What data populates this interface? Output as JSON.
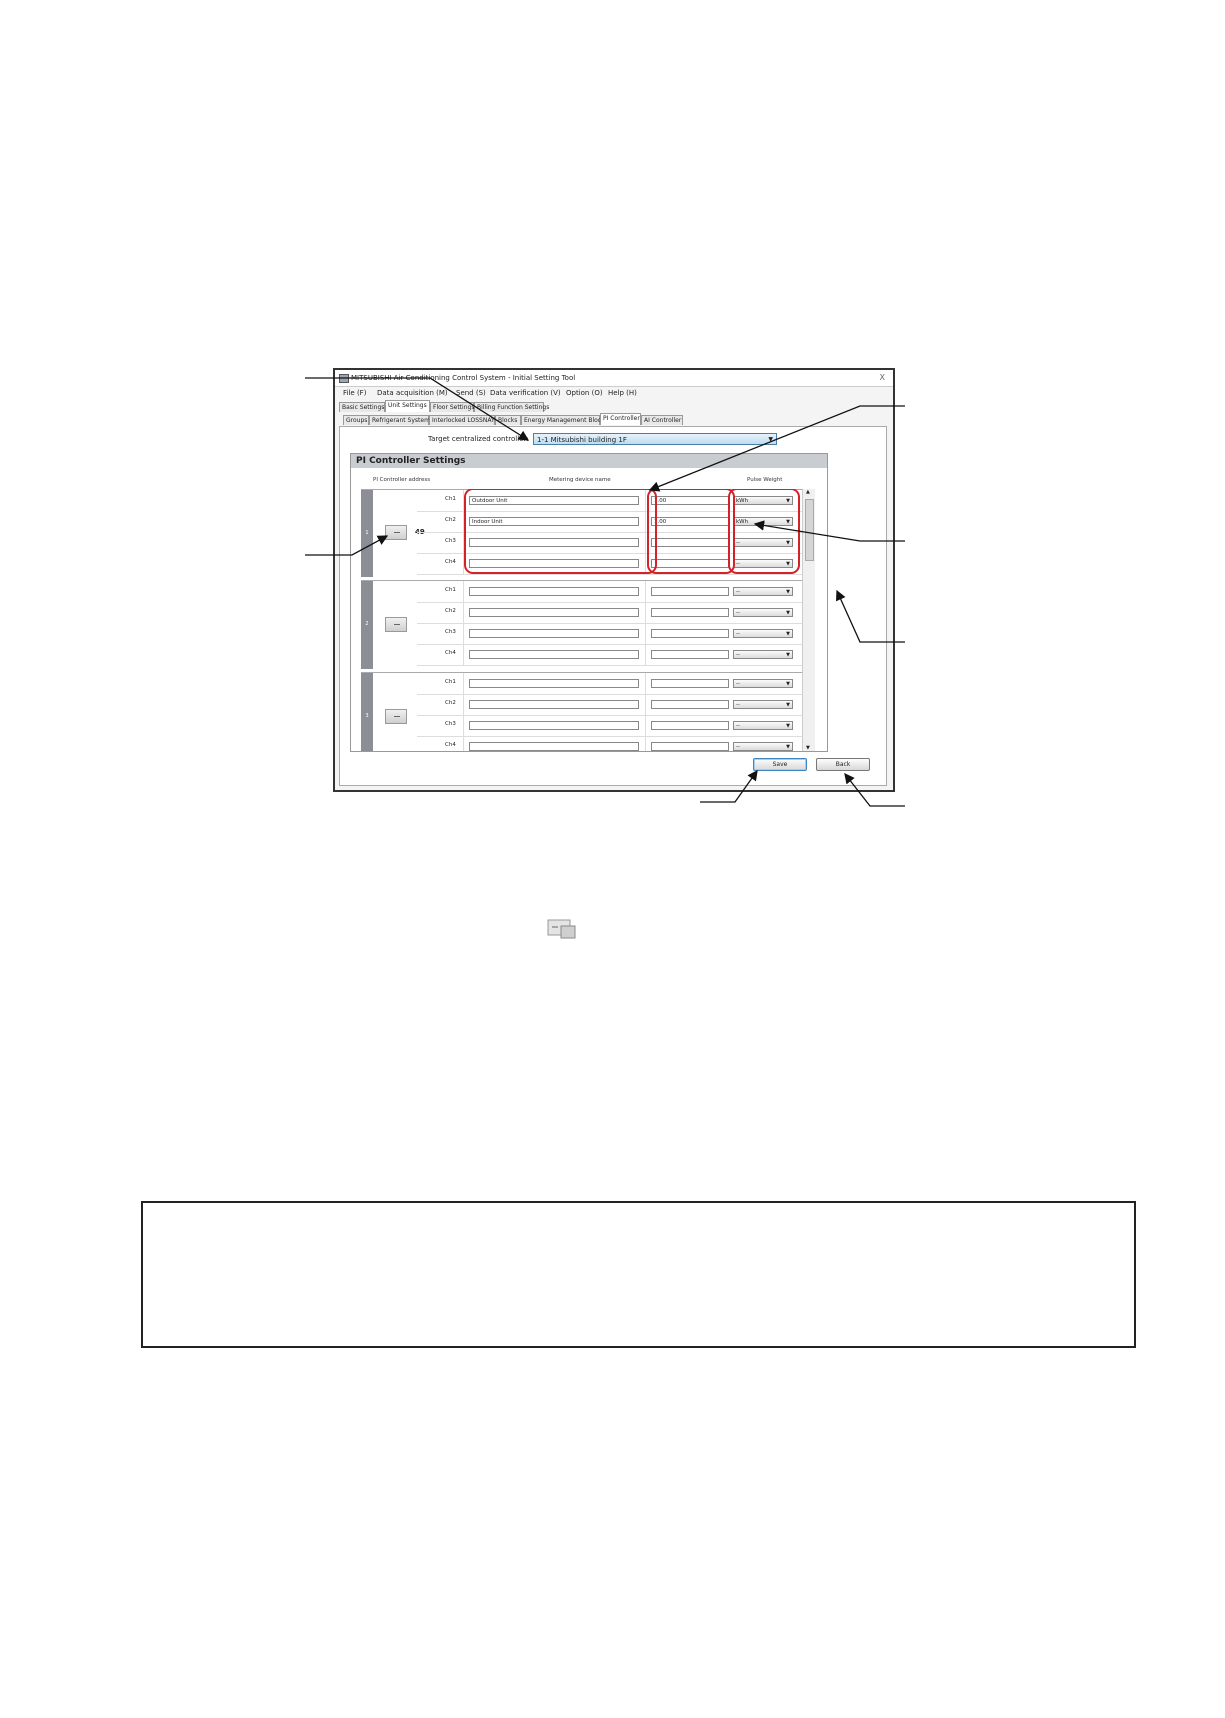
{
  "window": {
    "title": "MITSUBISHI Air Conditioning Control System - Initial Setting Tool",
    "close": "X"
  },
  "menu": [
    "File (F)",
    "Data acquisition (M)",
    "Send (S)",
    "Data verification (V)",
    "Option (O)",
    "Help (H)"
  ],
  "tabs_main": [
    "Basic Settings",
    "Unit Settings",
    "Floor Settings",
    "Billing Function Settings"
  ],
  "tabs_sub": [
    "Groups",
    "Refrigerant System",
    "Interlocked LOSSNAY",
    "Blocks",
    "Energy Management Block",
    "PI Controller",
    "AI Controller"
  ],
  "target": {
    "label": "Target centralized controller:",
    "value": "1-1  Mitsubishi building 1F"
  },
  "panel": {
    "title": "PI Controller Settings",
    "col_address": "PI Controller address",
    "col_name": "Metering device name",
    "col_pulse": "Pulse Weight"
  },
  "groups": [
    {
      "index": "1",
      "address": "49",
      "channels": [
        {
          "ch": "Ch1",
          "name": "Outdoor Unit",
          "pulse": "1.00",
          "unit": "kWh"
        },
        {
          "ch": "Ch2",
          "name": "Indoor Unit",
          "pulse": "1.00",
          "unit": "kWh"
        },
        {
          "ch": "Ch3",
          "name": "",
          "pulse": "",
          "unit": "--"
        },
        {
          "ch": "Ch4",
          "name": "",
          "pulse": "",
          "unit": "--"
        }
      ]
    },
    {
      "index": "2",
      "address": "",
      "channels": [
        {
          "ch": "Ch1",
          "name": "",
          "pulse": "",
          "unit": "--"
        },
        {
          "ch": "Ch2",
          "name": "",
          "pulse": "",
          "unit": "--"
        },
        {
          "ch": "Ch3",
          "name": "",
          "pulse": "",
          "unit": "--"
        },
        {
          "ch": "Ch4",
          "name": "",
          "pulse": "",
          "unit": "--"
        }
      ]
    },
    {
      "index": "3",
      "address": "",
      "channels": [
        {
          "ch": "Ch1",
          "name": "",
          "pulse": "",
          "unit": "--"
        },
        {
          "ch": "Ch2",
          "name": "",
          "pulse": "",
          "unit": "--"
        },
        {
          "ch": "Ch3",
          "name": "",
          "pulse": "",
          "unit": "--"
        },
        {
          "ch": "Ch4",
          "name": "",
          "pulse": "",
          "unit": "--"
        }
      ]
    }
  ],
  "buttons": {
    "save": "Save",
    "back": "Back"
  },
  "colors": {
    "highlight": "#d2232a",
    "panel_header": "#c9ccd1",
    "group_bar": "#8b8e94",
    "select_accent": "#4a7fa8"
  },
  "icons": {
    "pi_controller": "pi-controller-icon",
    "dropdown": "chevron-down-icon"
  }
}
